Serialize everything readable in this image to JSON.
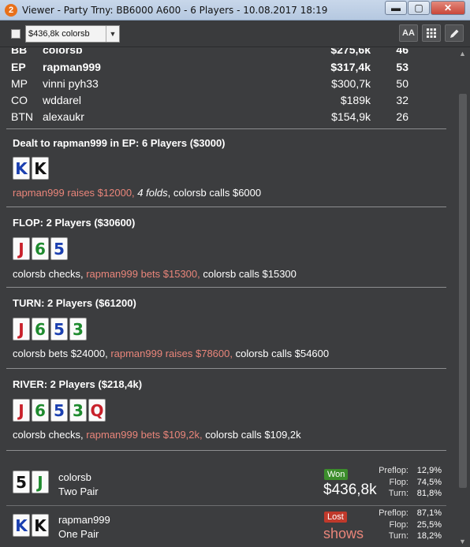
{
  "window": {
    "app_icon": "2",
    "title": "Viewer - Party Trny: BB6000 A600 - 6 Players - 10.08.2017 18:19",
    "buttons": {
      "minimize": "▬",
      "maximize": "▢",
      "close": "✕"
    }
  },
  "toolbar": {
    "selected_player": "$436,8k colorsb",
    "font_size_label": "AA"
  },
  "players": [
    {
      "pos": "BB",
      "name": "colorsb",
      "stack": "$275,6k",
      "bb": "46",
      "bold": true
    },
    {
      "pos": "EP",
      "name": "rapman999",
      "stack": "$317,4k",
      "bb": "53",
      "bold": true
    },
    {
      "pos": "MP",
      "name": "vinni pyh33",
      "stack": "$300,7k",
      "bb": "50",
      "bold": false
    },
    {
      "pos": "CO",
      "name": "wddarel",
      "stack": "$189k",
      "bb": "32",
      "bold": false
    },
    {
      "pos": "BTN",
      "name": "alexaukr",
      "stack": "$154,9k",
      "bb": "26",
      "bold": false
    }
  ],
  "preflop": {
    "header": "Dealt to rapman999 in EP: 6 Players ($3000)",
    "cards": [
      {
        "rank": "K",
        "color": "#1a3fb0"
      },
      {
        "rank": "K",
        "color": "#111111"
      }
    ],
    "actions": [
      {
        "text": "rapman999 raises $12000,",
        "style": "hl"
      },
      {
        "text": " ",
        "style": ""
      },
      {
        "text": "4 folds",
        "style": "it"
      },
      {
        "text": ", colorsb calls $6000",
        "style": ""
      }
    ]
  },
  "flop": {
    "header": "FLOP: 2 Players ($30600)",
    "cards": [
      {
        "rank": "J",
        "color": "#c8202a"
      },
      {
        "rank": "6",
        "color": "#1e8a2e"
      },
      {
        "rank": "5",
        "color": "#1a3fb0"
      }
    ],
    "actions": [
      {
        "text": "colorsb checks, ",
        "style": ""
      },
      {
        "text": "rapman999 bets $15300,",
        "style": "hl"
      },
      {
        "text": " colorsb calls $15300",
        "style": ""
      }
    ]
  },
  "turn": {
    "header": "TURN: 2 Players ($61200)",
    "cards": [
      {
        "rank": "J",
        "color": "#c8202a"
      },
      {
        "rank": "6",
        "color": "#1e8a2e"
      },
      {
        "rank": "5",
        "color": "#1a3fb0"
      },
      {
        "rank": "3",
        "color": "#1e8a2e"
      }
    ],
    "actions": [
      {
        "text": "colorsb bets $24000, ",
        "style": ""
      },
      {
        "text": "rapman999 raises $78600,",
        "style": "hl"
      },
      {
        "text": " colorsb calls $54600",
        "style": ""
      }
    ]
  },
  "river": {
    "header": "RIVER: 2 Players ($218,4k)",
    "cards": [
      {
        "rank": "J",
        "color": "#c8202a"
      },
      {
        "rank": "6",
        "color": "#1e8a2e"
      },
      {
        "rank": "5",
        "color": "#1a3fb0"
      },
      {
        "rank": "3",
        "color": "#1e8a2e"
      },
      {
        "rank": "Q",
        "color": "#c8202a"
      }
    ],
    "actions": [
      {
        "text": "colorsb checks, ",
        "style": ""
      },
      {
        "text": "rapman999 bets $109,2k,",
        "style": "hl"
      },
      {
        "text": " colorsb calls $109,2k",
        "style": ""
      }
    ]
  },
  "showdown": [
    {
      "name": "colorsb",
      "hand": "Two Pair",
      "cards": [
        {
          "rank": "5",
          "color": "#111111"
        },
        {
          "rank": "J",
          "color": "#1e8a2e"
        }
      ],
      "result": "Won",
      "amount": "$436,8k",
      "stats": [
        {
          "label": "Preflop:",
          "value": "12,9%"
        },
        {
          "label": "Flop:",
          "value": "74,5%"
        },
        {
          "label": "Turn:",
          "value": "81,8%"
        }
      ]
    },
    {
      "name": "rapman999",
      "hand": "One Pair",
      "cards": [
        {
          "rank": "K",
          "color": "#1a3fb0"
        },
        {
          "rank": "K",
          "color": "#111111"
        }
      ],
      "result": "Lost",
      "amount": "shows",
      "stats": [
        {
          "label": "Preflop:",
          "value": "87,1%"
        },
        {
          "label": "Flop:",
          "value": "25,5%"
        },
        {
          "label": "Turn:",
          "value": "18,2%"
        }
      ]
    }
  ]
}
